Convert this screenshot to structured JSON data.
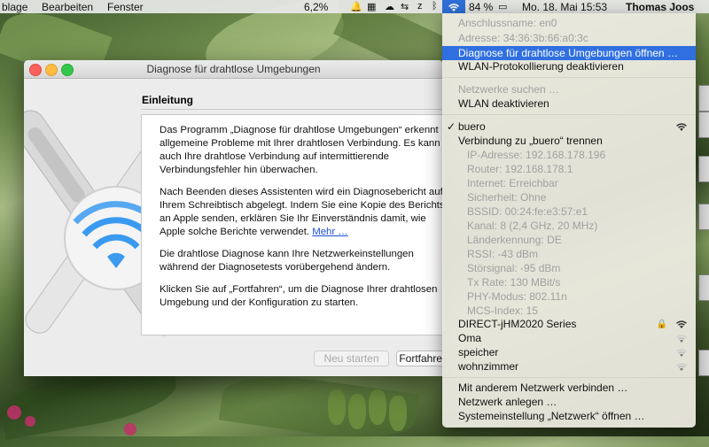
{
  "menubar": {
    "items": [
      "blage",
      "Bearbeiten",
      "Fenster"
    ],
    "battery_percent_left": "6,2%",
    "battery_percent": "84 %",
    "datetime": "Mo. 18. Mai  15:53",
    "user": "Thomas Joos"
  },
  "window": {
    "title": "Diagnose für drahtlose Umgebungen",
    "heading": "Einleitung",
    "paragraphs": [
      "Das Programm „Diagnose für drahtlose Umgebungen“ erkennt allgemeine Probleme mit Ihrer drahtlosen Verbindung. Es kann auch Ihre drahtlose Verbindung auf intermittierende Verbindungsfehler hin überwachen.",
      "Nach Beenden dieses Assistenten wird ein Diagnosebericht auf Ihrem Schreibtisch abgelegt. Indem Sie eine Kopie des Berichts an Apple senden, erklären Sie Ihr Einverständnis damit, wie Apple solche Berichte verwendet.",
      "Die drahtlose Diagnose kann Ihre Netzwerkeinstellungen während der Diagnosetests vorübergehend ändern.",
      "Klicken Sie auf „Fortfahren“, um die Diagnose Ihrer drahtlosen Umgebung und der Konfiguration zu starten."
    ],
    "more_link": "Mehr …",
    "restart_button": "Neu starten",
    "continue_button": "Fortfahren"
  },
  "wifi_menu": {
    "interface_name": "Anschlussname: en0",
    "address": "Adresse: 34:36:3b:66:a0:3c",
    "open_diagnostics": "Diagnose für drahtlose Umgebungen öffnen …",
    "disable_logging": "WLAN-Protokollierung deaktivieren",
    "search_networks": "Netzwerke suchen …",
    "disable_wlan": "WLAN deaktivieren",
    "current_network": "buero",
    "disconnect": "Verbindung zu „buero“ trennen",
    "details": [
      "IP-Adresse: 192.168.178.196",
      "Router: 192.168.178.1",
      "Internet: Erreichbar",
      "Sicherheit: Ohne",
      "BSSID: 00:24:fe:e3:57:e1",
      "Kanal: 8 (2,4 GHz, 20 MHz)",
      "Länderkennung: DE",
      "RSSI: -43 dBm",
      "Störsignal: -95 dBm",
      "Tx Rate: 130 MBit/s",
      "PHY-Modus: 802.11n",
      "MCS-Index: 15"
    ],
    "other_networks": [
      "DIRECT-jHM2020 Series",
      "Oma",
      "speicher",
      "wohnzimmer"
    ],
    "connect_other": "Mit anderem Netzwerk verbinden …",
    "create_network": "Netzwerk anlegen …",
    "open_preferences": "Systemeinstellung „Netzwerk“ öffnen …"
  },
  "colors": {
    "highlight": "#2f6fe0",
    "link": "#1a4fd6"
  }
}
